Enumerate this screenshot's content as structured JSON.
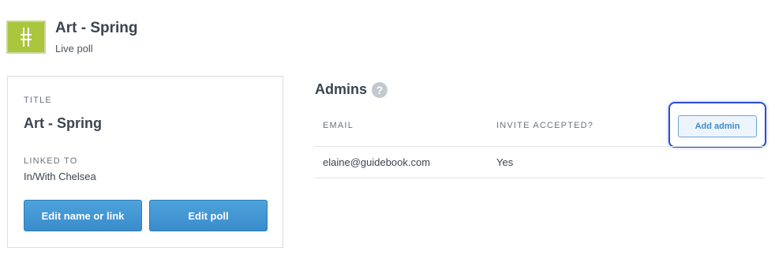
{
  "header": {
    "logo_icon": "hashtag-logo-icon",
    "logo_color": "#a9c63c",
    "title": "Art - Spring",
    "subtitle": "Live poll"
  },
  "card": {
    "title_label": "TITLE",
    "title_value": "Art - Spring",
    "linked_label": "LINKED TO",
    "linked_value": "In/With Chelsea",
    "edit_name_button": "Edit name or link",
    "edit_poll_button": "Edit poll"
  },
  "admins": {
    "heading": "Admins",
    "help_icon": "?",
    "columns": [
      "EMAIL",
      "INVITE ACCEPTED?"
    ],
    "add_admin_button": "Add admin",
    "rows": [
      {
        "email": "elaine@guidebook.com",
        "accepted": "Yes"
      }
    ]
  },
  "colors": {
    "primary_button": "#3a8ccb",
    "highlight_border": "#2d4fd1"
  }
}
